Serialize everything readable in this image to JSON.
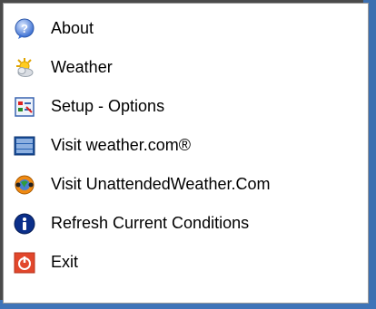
{
  "menu": {
    "items": [
      {
        "label": "About",
        "icon": "help-icon"
      },
      {
        "label": "Weather",
        "icon": "weather-icon"
      },
      {
        "label": "Setup - Options",
        "icon": "options-icon"
      },
      {
        "label": "Visit weather.com®",
        "icon": "weather-channel-icon"
      },
      {
        "label": "Visit UnattendedWeather.Com",
        "icon": "web-globe-icon"
      },
      {
        "label": "Refresh Current Conditions",
        "icon": "info-icon"
      },
      {
        "label": "Exit",
        "icon": "exit-icon"
      }
    ]
  },
  "colors": {
    "menu_background": "#ffffff",
    "menu_border": "#9b9b9b",
    "desktop_background": "#4a4a4a",
    "taskbar_blue": "#3c6fb0"
  }
}
